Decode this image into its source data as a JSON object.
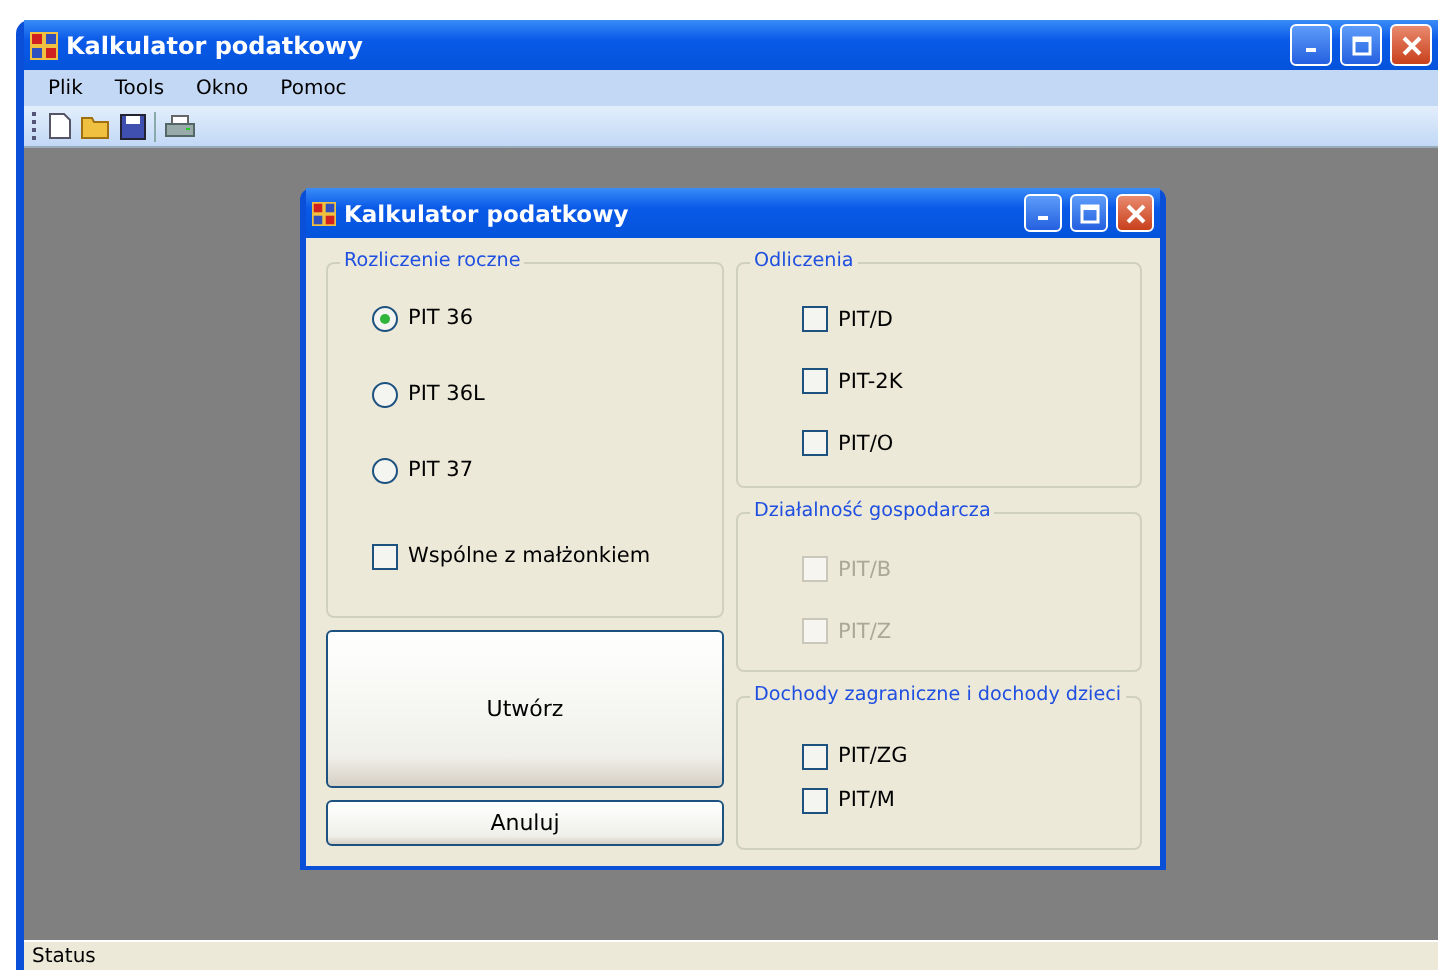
{
  "window": {
    "title": "Kalkulator podatkowy"
  },
  "menu": [
    "Plik",
    "Tools",
    "Okno",
    "Pomoc"
  ],
  "toolbar": [
    {
      "kind": "new"
    },
    {
      "kind": "open"
    },
    {
      "kind": "save"
    },
    {
      "kind": "sep"
    },
    {
      "kind": "print"
    }
  ],
  "dialog": {
    "title": "Kalkulator podatkowy",
    "left_group": {
      "title": "Rozliczenie roczne",
      "items": [
        {
          "kind": "radio",
          "label": "PIT 36",
          "checked": true,
          "disabled": false
        },
        {
          "kind": "radio",
          "label": "PIT 36L",
          "checked": false,
          "disabled": false
        },
        {
          "kind": "radio",
          "label": "PIT 37",
          "checked": false,
          "disabled": false
        },
        {
          "kind": "checkbox",
          "label": "Wspólne z małżonkiem",
          "checked": false,
          "disabled": false
        }
      ]
    },
    "buttons": [
      "Utwórz",
      "Anuluj"
    ],
    "right_groups": [
      {
        "title": "Odliczenia",
        "items": [
          {
            "kind": "checkbox",
            "label": "PIT/D",
            "checked": false,
            "disabled": false
          },
          {
            "kind": "checkbox",
            "label": "PIT-2K",
            "checked": false,
            "disabled": false
          },
          {
            "kind": "checkbox",
            "label": "PIT/O",
            "checked": false,
            "disabled": false
          }
        ]
      },
      {
        "title": "Działalność gospodarcza",
        "items": [
          {
            "kind": "checkbox",
            "label": "PIT/B",
            "checked": false,
            "disabled": true
          },
          {
            "kind": "checkbox",
            "label": "PIT/Z",
            "checked": false,
            "disabled": true
          }
        ]
      },
      {
        "title": "Dochody zagraniczne i dochody dzieci",
        "items": [
          {
            "kind": "checkbox",
            "label": "PIT/ZG",
            "checked": false,
            "disabled": false
          },
          {
            "kind": "checkbox",
            "label": "PIT/M",
            "checked": false,
            "disabled": false
          }
        ]
      }
    ]
  },
  "status_bar": "Status"
}
